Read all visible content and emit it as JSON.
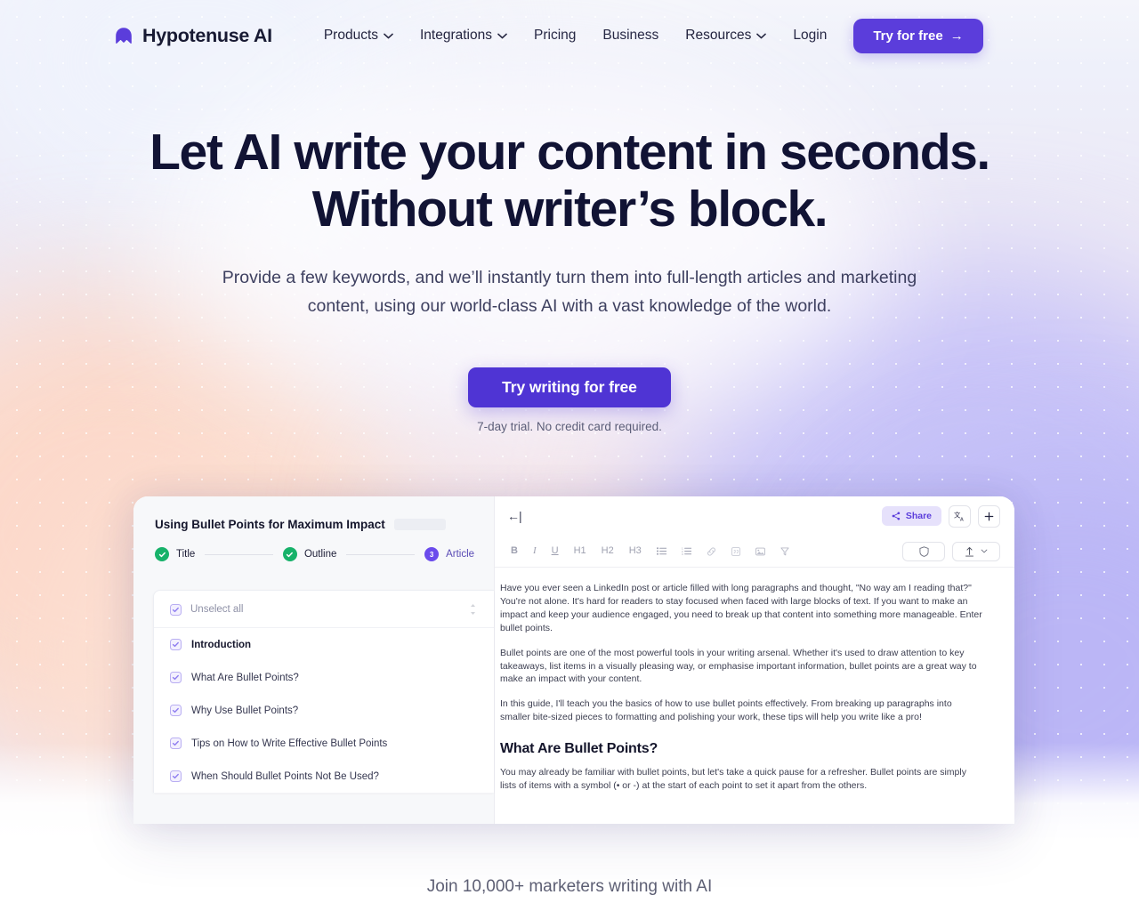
{
  "brand": {
    "name": "Hypotenuse AI",
    "logo_icon": "hypotenuse-arch-logo",
    "accent": "#5b3ddb"
  },
  "nav": {
    "items": [
      {
        "label": "Products",
        "has_dropdown": true
      },
      {
        "label": "Integrations",
        "has_dropdown": true
      },
      {
        "label": "Pricing",
        "has_dropdown": false
      },
      {
        "label": "Business",
        "has_dropdown": false
      },
      {
        "label": "Resources",
        "has_dropdown": true
      },
      {
        "label": "Login",
        "has_dropdown": false
      }
    ],
    "cta": {
      "label": "Try for free",
      "arrow": "→"
    }
  },
  "hero": {
    "headline_line1": "Let AI write your content in seconds.",
    "headline_line2": "Without writer’s block.",
    "subhead_line1": "Provide a few keywords, and we’ll instantly turn them into full-length articles and",
    "subhead_line2": "marketing content, using our world-class AI with a vast knowledge of the world.",
    "cta_label": "Try writing for free",
    "cta_subtext": "7-day trial. No credit card required."
  },
  "app": {
    "document_title": "Using Bullet Points for Maximum Impact",
    "steps": [
      {
        "label": "Title",
        "state": "done",
        "marker": "✓"
      },
      {
        "label": "Outline",
        "state": "done",
        "marker": "✓"
      },
      {
        "label": "Article",
        "state": "active",
        "marker": "3"
      }
    ],
    "outline": {
      "select_all_label": "Unselect all",
      "items": [
        {
          "label": "Introduction",
          "checked": true
        },
        {
          "label": "What Are Bullet Points?",
          "checked": true
        },
        {
          "label": "Why Use Bullet Points?",
          "checked": true
        },
        {
          "label": "Tips on How to Write Effective Bullet Points",
          "checked": true
        },
        {
          "label": "When Should Bullet Points Not Be Used?",
          "checked": true
        }
      ]
    },
    "editor": {
      "back_icon": "back-arrow-icon",
      "share_label": "Share",
      "share_icon": "share-icon",
      "translate_icon": "translate-icon",
      "add_icon": "plus-icon",
      "shield_icon": "shield-icon",
      "publish_icon": "upload-icon",
      "toolbar": [
        {
          "name": "bold",
          "label": "B"
        },
        {
          "name": "italic",
          "label": "I"
        },
        {
          "name": "underline",
          "label": "U"
        },
        {
          "name": "heading-1",
          "label": "H1"
        },
        {
          "name": "heading-2",
          "label": "H2"
        },
        {
          "name": "heading-3",
          "label": "H3"
        },
        {
          "name": "bullet-list",
          "label": "☰"
        },
        {
          "name": "numbered-list",
          "label": "☰"
        },
        {
          "name": "link",
          "label": "⚭"
        },
        {
          "name": "quote",
          "label": "❝"
        },
        {
          "name": "image",
          "label": "▣"
        },
        {
          "name": "clear-format",
          "label": "✄"
        }
      ],
      "paragraphs": [
        "Have you ever seen a LinkedIn post or article filled with long paragraphs and thought, \"No way am I reading that?\" You're not alone. It's hard for readers to stay focused when faced with large blocks of text. If you want to make an impact and keep your audience engaged, you need to break up that content into something more manageable. Enter bullet points.",
        "Bullet points are one of the most powerful tools in your writing arsenal. Whether it's used to draw attention to key takeaways, list items in a visually pleasing way, or emphasise important information, bullet points are a great way to make an impact with your content.",
        "In this guide, I'll teach you the basics of how to use bullet points effectively. From breaking up paragraphs into smaller bite-sized pieces to formatting and polishing your work, these tips will help you write like a pro!"
      ],
      "section_heading": "What Are Bullet Points?",
      "section_paragraph": "You may already be familiar with bullet points, but let's take a quick pause for a refresher. Bullet points are simply lists of items with a symbol (• or -) at the start of each point to set it apart from the others."
    }
  },
  "footer": {
    "social_proof": "Join 10,000+ marketers writing with AI"
  }
}
